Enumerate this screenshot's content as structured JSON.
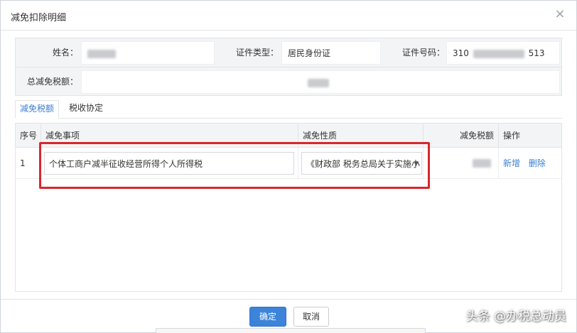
{
  "dialog": {
    "title": "减免扣除明细",
    "close_glyph": "×"
  },
  "info": {
    "name_label": "姓名：",
    "name_value": "",
    "id_type_label": "证件类型：",
    "id_type_value": "居民身份证",
    "id_no_label": "证件号码：",
    "id_no_prefix": "310",
    "id_no_suffix": "513",
    "total_label": "总减免税额："
  },
  "tabs": [
    {
      "label": "减免税额",
      "active": true
    },
    {
      "label": "税收协定",
      "active": false
    }
  ],
  "table": {
    "headers": {
      "index": "序号",
      "item": "减免事项",
      "nature": "减免性质",
      "amount": "减免税额",
      "action": "操作"
    },
    "rows": [
      {
        "index": "1",
        "item": "个体工商户减半征收经营所得个人所得税",
        "nature": "《财政部 税务总局关于实施小",
        "add": "新增",
        "delete": "删除"
      }
    ]
  },
  "footer": {
    "confirm": "确定",
    "cancel": "取消"
  },
  "watermark": "头条 @办税总动员",
  "colors": {
    "primary": "#3c84d9",
    "link": "#3b7fd4",
    "highlight": "#d8272c"
  }
}
